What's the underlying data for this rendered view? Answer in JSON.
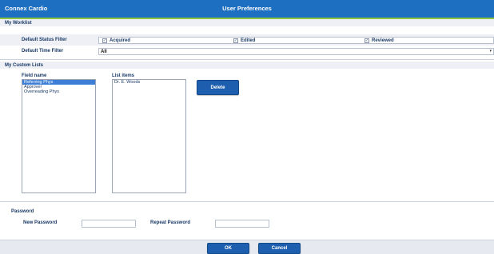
{
  "window": {
    "app_name": "Connex Cardio",
    "title": "User Preferences"
  },
  "my_worklist": {
    "section_label": "My Worklist",
    "status_filter_label": "Default Status Filter",
    "status_options": [
      {
        "label": "Acquired",
        "checked": true
      },
      {
        "label": "Edited",
        "checked": true
      },
      {
        "label": "Reviewed",
        "checked": true
      }
    ],
    "time_filter_label": "Default Time Filter",
    "time_filter_value": "All"
  },
  "custom_lists": {
    "section_label": "My Custom Lists",
    "field_name_header": "Field name",
    "list_items_header": "List items",
    "field_names": [
      {
        "label": "Referring Phys",
        "selected": true
      },
      {
        "label": "Approver",
        "selected": false
      },
      {
        "label": "Overreading Phys",
        "selected": false
      }
    ],
    "list_items": [
      "Dr. E. Woods"
    ],
    "delete_label": "Delete"
  },
  "password": {
    "section_label": "Password",
    "new_label": "New Password",
    "repeat_label": "Repeat Password",
    "new_value": "",
    "repeat_value": ""
  },
  "footer": {
    "ok_label": "OK",
    "cancel_label": "Cancel"
  },
  "colors": {
    "title_bar": "#1d6fc2",
    "accent": "#8cc63f",
    "button": "#1d5fae",
    "selection": "#3d7fd6",
    "text": "#1a3a66"
  }
}
